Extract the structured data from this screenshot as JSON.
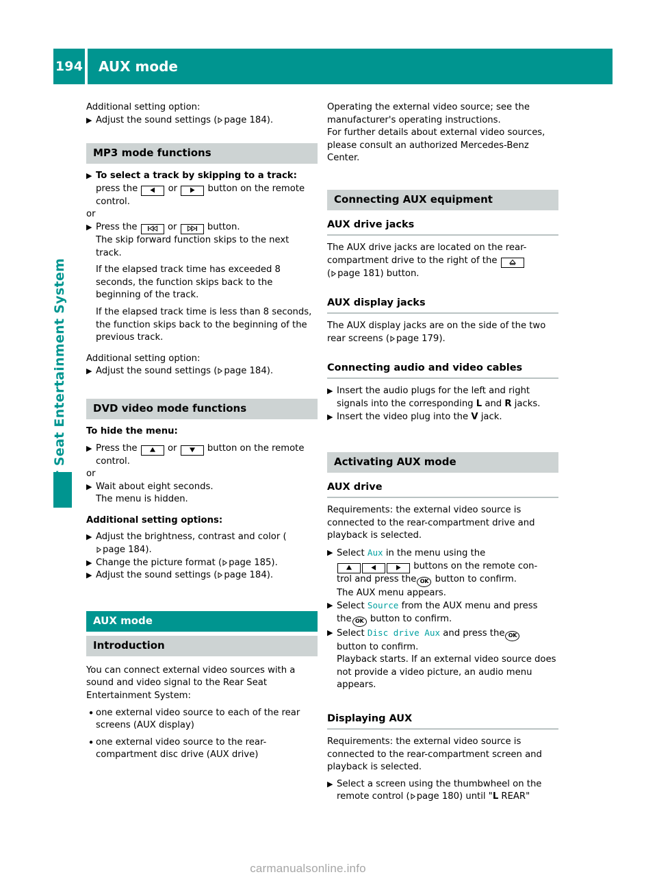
{
  "header": {
    "page_number": "194",
    "title": "AUX mode",
    "accent_color": "#009590"
  },
  "sidebar": {
    "label": "Rear Seat Entertainment System"
  },
  "footer": {
    "watermark": "carmanualsonline.info"
  },
  "left_column": {
    "intro_label": "Additional setting option:",
    "intro_step": {
      "text_before": "Adjust the sound settings (",
      "page_ref": "page 184",
      "text_after": ")."
    },
    "mp3": {
      "heading": "MP3 mode functions",
      "step1_bold": "To select a track by skipping to a track:",
      "step1_line1_a": "press the",
      "step1_line1_b": "or",
      "step1_line1_c": "button on the remote",
      "step1_line2": "control.",
      "or": "or",
      "step2_a": "Press the",
      "step2_b": "or",
      "step2_c": "button.",
      "step2_detail": "The skip forward function skips to the next track.",
      "para1": "If the elapsed track time has exceeded 8 seconds, the function skips back to the beginning of the track.",
      "para2": "If the elapsed track time is less than 8 seconds, the function skips back to the beginning of the previous track.",
      "setting_label": "Additional setting option:",
      "setting_step": {
        "text_before": "Adjust the sound settings (",
        "page_ref": "page 184",
        "text_after": ")."
      }
    },
    "dvd": {
      "heading": "DVD video mode functions",
      "hide_menu_label": "To hide the menu:",
      "step1_a": "Press the",
      "step1_b": "or",
      "step1_c": "button on the remote",
      "step1_line2": "control.",
      "or": "or",
      "step2": "Wait about eight seconds.",
      "step2_detail": "The menu is hidden.",
      "options_label": "Additional setting options:",
      "option1": {
        "text_before": "Adjust the brightness, contrast and color (",
        "page_ref": "page 184",
        "text_after": ")."
      },
      "option2": {
        "text_before": "Change the picture format (",
        "page_ref": "page 185",
        "text_after": ")."
      },
      "option3": {
        "text_before": "Adjust the sound settings (",
        "page_ref": "page 184",
        "text_after": ")."
      }
    },
    "aux": {
      "heading": "AUX mode",
      "subheading": "Introduction",
      "para": "You can connect external video sources with a sound and video signal to the Rear Seat Entertainment System:",
      "bullets": [
        "one external video source to each of the rear screens (AUX display)",
        "one external video source to the rear-compartment disc drive (AUX drive)"
      ]
    }
  },
  "right_column": {
    "top_para1": "Operating the external video source; see the manufacturer's operating instructions.",
    "top_para2": "For further details about external video sources, please consult an authorized Mercedes-Benz Center.",
    "connecting": {
      "heading": "Connecting AUX equipment",
      "drive_jacks": {
        "heading": "AUX drive jacks",
        "text_a": "The AUX drive jacks are located on the rear-compartment drive to the right of the",
        "page_ref": "page 181",
        "text_b": ") button."
      },
      "display_jacks": {
        "heading": "AUX display jacks",
        "text_before": "The AUX display jacks are on the side of the two rear screens (",
        "page_ref": "page 179",
        "text_after": ")."
      },
      "cables": {
        "heading": "Connecting audio and video cables",
        "step1_a": "Insert the audio plugs for the left and right signals into the corresponding",
        "step1_l": "L",
        "step1_and": "and",
        "step1_r": "R",
        "step1_end": "jacks.",
        "step2_a": "Insert the video plug into the",
        "step2_v": "V",
        "step2_end": "jack."
      }
    },
    "activating": {
      "heading": "Activating AUX mode",
      "drive": {
        "heading": "AUX drive",
        "requirements": "Requirements: the external video source is connected to the rear-compartment drive and playback is selected.",
        "step1_a": "Select",
        "step1_menu": "Aux",
        "step1_b": "in the menu using the",
        "step1_c": "buttons on the remote con-",
        "step1_d": "trol and press the",
        "step1_e": "button to confirm.",
        "step1_result": "The AUX menu appears.",
        "step2_a": "Select",
        "step2_menu": "Source",
        "step2_b": "from the AUX menu and press",
        "step2_c": "the",
        "step2_d": "button to confirm.",
        "step3_a": "Select",
        "step3_menu": "Disc drive Aux",
        "step3_b": "and press the",
        "step3_c": "button to confirm.",
        "step3_result": "Playback starts. If an external video source does not provide a video picture, an audio menu appears."
      },
      "displaying": {
        "heading": "Displaying AUX",
        "requirements": "Requirements: the external video source is connected to the rear-compartment screen and playback is selected.",
        "step1_a": "Select a screen using the thumbwheel on the remote control (",
        "page_ref": "page 180",
        "step1_b": ") until \"",
        "step1_bold": "L",
        "step1_c": " REAR\""
      }
    }
  },
  "icons": {
    "skip_prev": "skip-previous-button-icon",
    "skip_next": "skip-next-button-icon",
    "arrow_left": "arrow-left-button-icon",
    "arrow_right": "arrow-right-button-icon",
    "arrow_up": "arrow-up-button-icon",
    "arrow_down": "arrow-down-button-icon",
    "eject": "eject-button-icon",
    "ok": "ok-button-icon",
    "page_ref": "page-reference-arrow-icon"
  }
}
